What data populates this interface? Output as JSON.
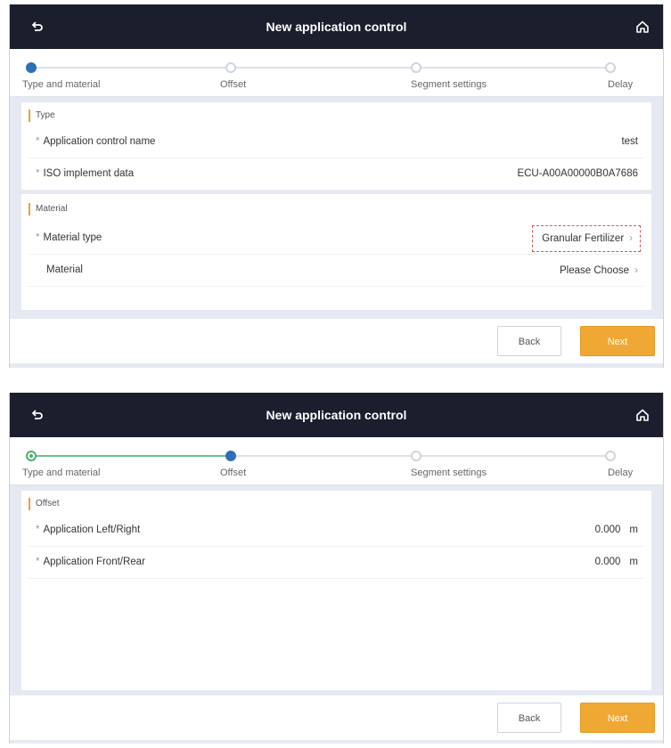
{
  "screens": [
    {
      "header": {
        "title": "New application control"
      },
      "steps": [
        {
          "label": "Type and material",
          "state": "active"
        },
        {
          "label": "Offset",
          "state": "pending"
        },
        {
          "label": "Segment settings",
          "state": "pending"
        },
        {
          "label": "Delay",
          "state": "pending"
        }
      ],
      "sections": [
        {
          "title": "Type",
          "rows": [
            {
              "label": "Application control name",
              "value": "test",
              "required": true
            },
            {
              "label": "ISO implement data",
              "value": "ECU-A00A00000B0A7686",
              "required": true
            }
          ]
        },
        {
          "title": "Material",
          "rows": [
            {
              "label": "Material type",
              "value": "Granular Fertilizer",
              "required": true,
              "chevron": true,
              "highlighted": true
            },
            {
              "label": "Material",
              "value": "Please Choose",
              "required": false,
              "chevron": true
            }
          ]
        }
      ],
      "footer": {
        "back_label": "Back",
        "next_label": "Next"
      }
    },
    {
      "header": {
        "title": "New application control"
      },
      "steps": [
        {
          "label": "Type and material",
          "state": "done"
        },
        {
          "label": "Offset",
          "state": "active"
        },
        {
          "label": "Segment settings",
          "state": "pending"
        },
        {
          "label": "Delay",
          "state": "pending"
        }
      ],
      "sections": [
        {
          "title": "Offset",
          "rows": [
            {
              "label": "Application Left/Right",
              "value": "0.000",
              "unit": "m",
              "required": true
            },
            {
              "label": "Application Front/Rear",
              "value": "0.000",
              "unit": "m",
              "required": true
            }
          ]
        }
      ],
      "footer": {
        "back_label": "Back",
        "next_label": "Next"
      }
    }
  ],
  "icons": {
    "back": "back-arrow-icon",
    "home": "home-icon",
    "chevron": "chevron-right-icon"
  },
  "colors": {
    "header_bg": "#1b1e2d",
    "accent": "#f0a834",
    "active_step": "#2f6fb3",
    "done_step": "#4caf6e",
    "highlight_border": "#d9534f"
  }
}
